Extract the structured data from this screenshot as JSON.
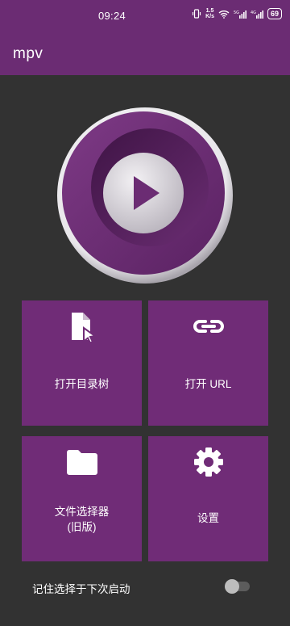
{
  "status_bar": {
    "time": "09:24",
    "net_speed": "1.5\nK/s",
    "battery": "69",
    "icons": [
      "vibrate-icon",
      "net-speed",
      "wifi-icon",
      "5g-signal-icon",
      "4g-signal-icon",
      "battery-icon"
    ]
  },
  "app": {
    "title": "mpv"
  },
  "tiles": {
    "open_tree": {
      "label": "打开目录树",
      "icon": "file-cursor-icon"
    },
    "open_url": {
      "label": "打开 URL",
      "icon": "link-icon"
    },
    "file_picker": {
      "label_line1": "文件选择器",
      "label_line2": "(旧版)",
      "icon": "folder-icon"
    },
    "settings": {
      "label": "设置",
      "icon": "gear-icon"
    }
  },
  "remember": {
    "label": "记住选择于下次启动",
    "enabled": false
  },
  "colors": {
    "primary": "#6b2c73",
    "tile": "#702c77",
    "background": "#323232"
  }
}
